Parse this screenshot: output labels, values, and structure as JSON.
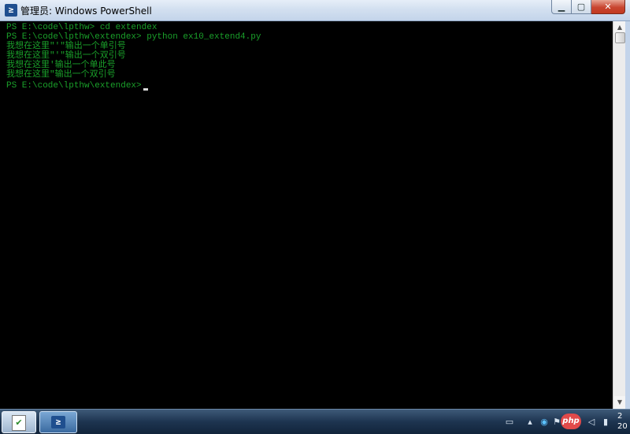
{
  "window": {
    "title": "管理员: Windows PowerShell",
    "icon": "powershell-icon",
    "controls": {
      "minimize": "▁",
      "maximize": "▢",
      "close": "✕"
    }
  },
  "console": {
    "lines": [
      "PS E:\\code\\lpthw> cd extendex",
      "PS E:\\code\\lpthw\\extendex> python ex10_extend4.py",
      "我想在这里\"'\"输出一个单引号",
      "我想在这里\"'\"输出一个双引号",
      "我想在这里'输出一个单此号",
      "我想在这里\"输出一个双引号",
      "PS E:\\code\\lpthw\\extendex> "
    ],
    "text_color": "#1aa02a",
    "background": "#000000"
  },
  "taskbar": {
    "start_icon": "start-orb-icon",
    "items": [
      {
        "name": "powershell-icon",
        "glyph": "≥"
      }
    ],
    "tray": {
      "badge_text": "php",
      "clock_time": "2",
      "clock_date": "20"
    }
  }
}
